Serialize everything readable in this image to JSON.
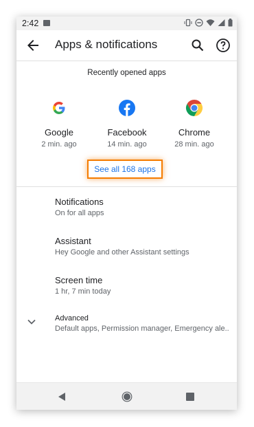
{
  "status_bar": {
    "time": "2:42",
    "icons": [
      "photo-icon",
      "vibrate-icon",
      "do-not-disturb-icon",
      "wifi-icon",
      "signal-icon",
      "battery-icon"
    ]
  },
  "app_bar": {
    "title": "Apps & notifications",
    "icons": [
      "back-arrow-icon",
      "search-icon",
      "help-icon"
    ]
  },
  "recent_apps": {
    "header": "Recently opened apps",
    "apps": [
      {
        "name": "Google",
        "time": "2 min. ago",
        "icon": "google-icon"
      },
      {
        "name": "Facebook",
        "time": "14 min. ago",
        "icon": "facebook-icon"
      },
      {
        "name": "Chrome",
        "time": "28 min. ago",
        "icon": "chrome-icon"
      }
    ],
    "see_all_label": "See all 168 apps"
  },
  "settings": [
    {
      "title": "Notifications",
      "summary": "On for all apps"
    },
    {
      "title": "Assistant",
      "summary": "Hey Google and other Assistant settings"
    },
    {
      "title": "Screen time",
      "summary": "1 hr, 7 min today"
    },
    {
      "title": "Advanced",
      "summary": "Default apps, Permission manager, Emergency ale.."
    }
  ],
  "nav_bar": {
    "icons": [
      "nav-back-icon",
      "nav-home-icon",
      "nav-recents-icon"
    ]
  },
  "colors": {
    "accent_blue": "#1a73e8",
    "highlight_orange": "#f57c00",
    "text_primary": "#202124",
    "text_secondary": "#5f6368"
  }
}
